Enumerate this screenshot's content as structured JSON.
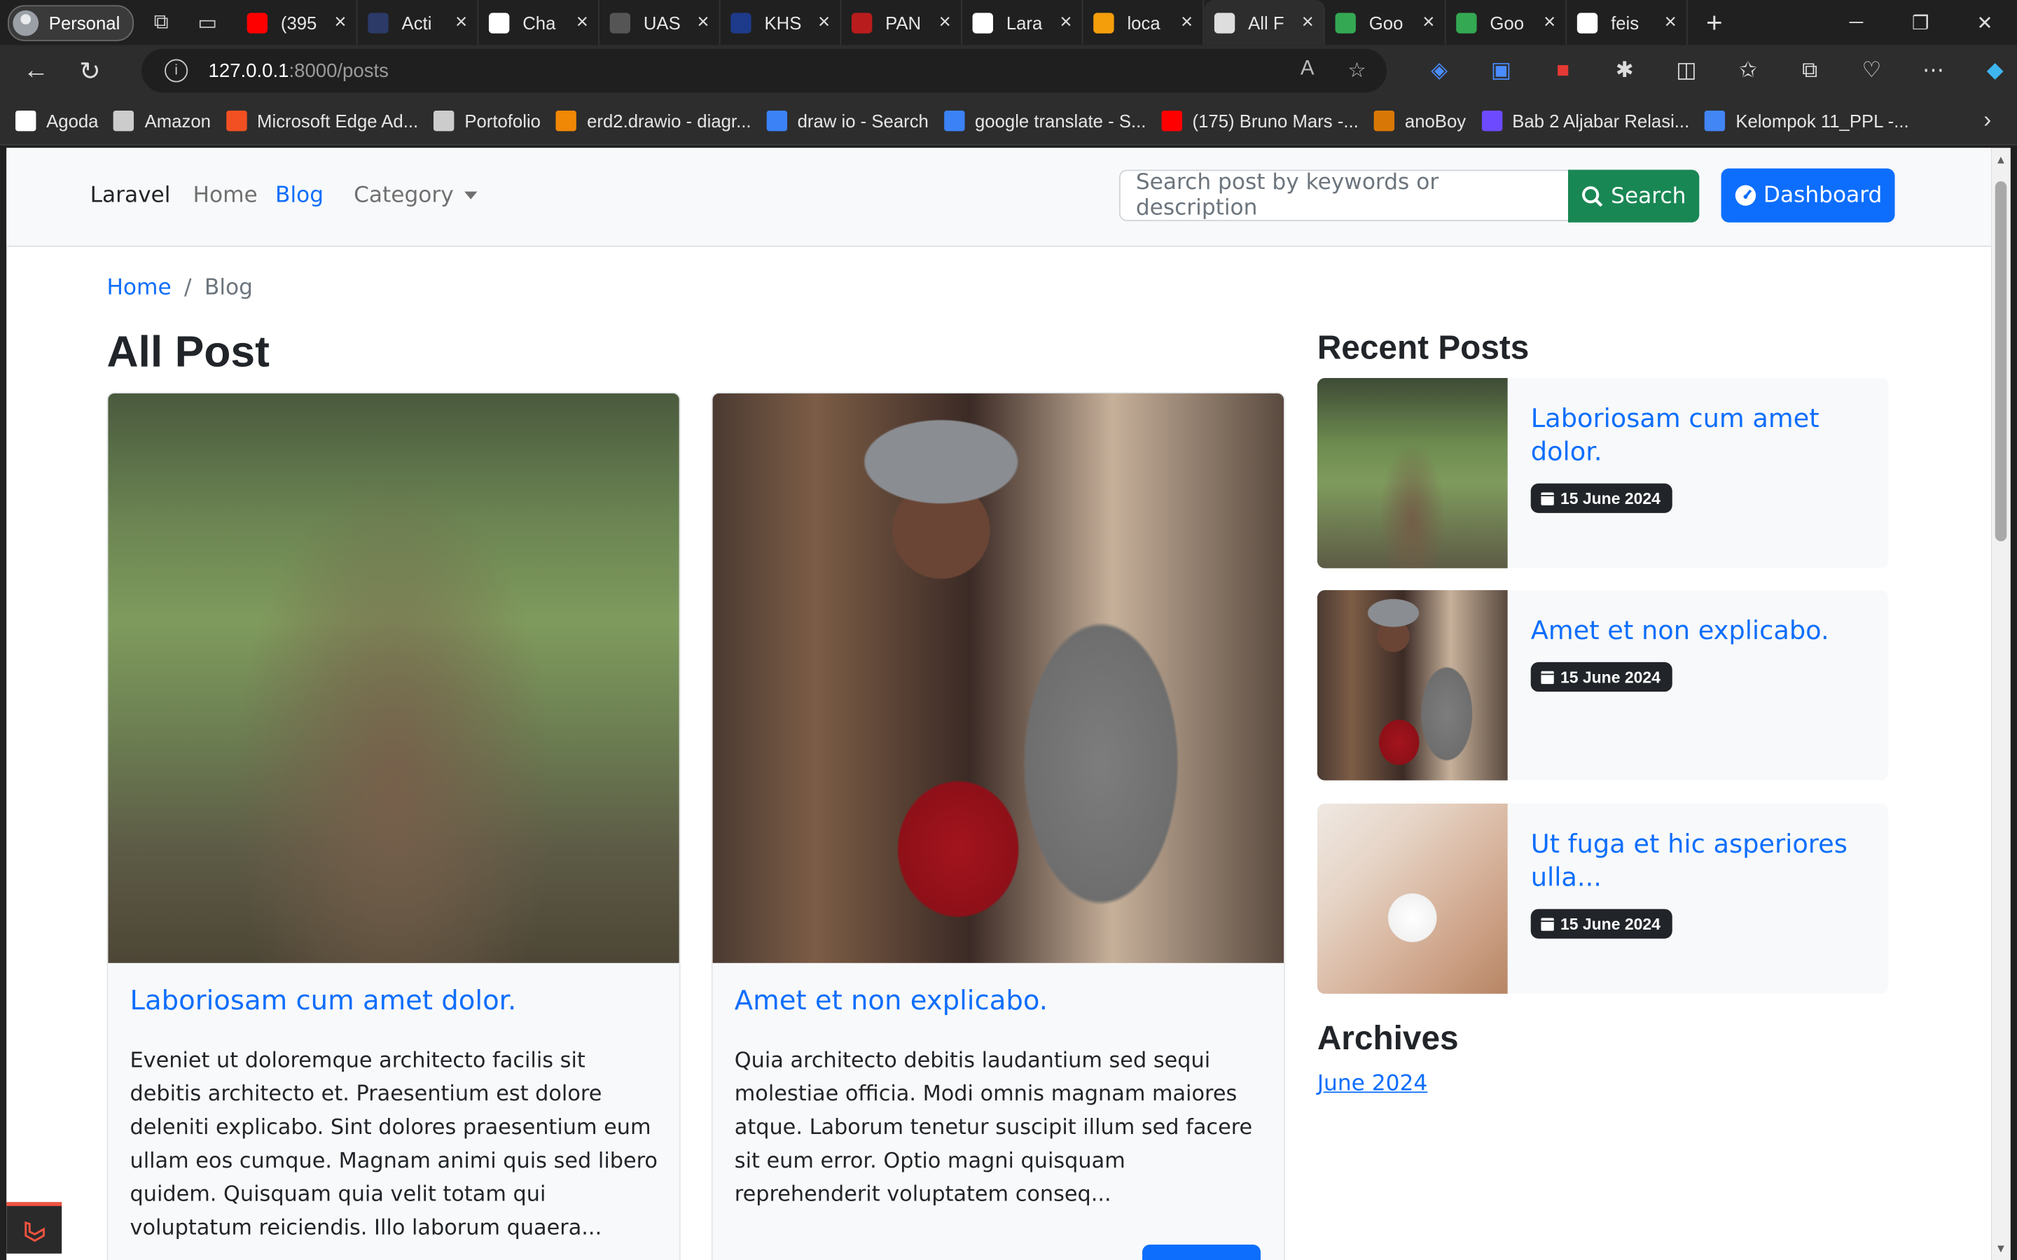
{
  "browser": {
    "profile": "Personal",
    "tabs": [
      {
        "title": "(395",
        "color": "#ff0000"
      },
      {
        "title": "Acti",
        "color": "#2b3a67"
      },
      {
        "title": "Cha",
        "color": "#ffffff"
      },
      {
        "title": "UAS",
        "color": "#555555"
      },
      {
        "title": "KHS",
        "color": "#1e3a8a"
      },
      {
        "title": "PAN",
        "color": "#b91c1c"
      },
      {
        "title": "Lara",
        "color": "#ffffff"
      },
      {
        "title": "loca",
        "color": "#f59e0b"
      },
      {
        "title": "All F",
        "color": "#dddddd",
        "active": true
      },
      {
        "title": "Goo",
        "color": "#34a853"
      },
      {
        "title": "Goo",
        "color": "#34a853"
      },
      {
        "title": "feis",
        "color": "#ffffff"
      }
    ],
    "url_host": "127.0.0.1",
    "url_path": ":8000/posts",
    "bookmarks": [
      {
        "label": "Agoda",
        "color": "#ffffff"
      },
      {
        "label": "Amazon",
        "color": "#cccccc"
      },
      {
        "label": "Microsoft Edge Ad...",
        "color": "#f25022"
      },
      {
        "label": "Portofolio",
        "color": "#cccccc"
      },
      {
        "label": "erd2.drawio - diagr...",
        "color": "#f08705"
      },
      {
        "label": "draw io - Search",
        "color": "#3b82f6"
      },
      {
        "label": "google translate - S...",
        "color": "#3b82f6"
      },
      {
        "label": "(175) Bruno Mars -...",
        "color": "#ff0000"
      },
      {
        "label": "anoBoy",
        "color": "#d97706"
      },
      {
        "label": "Bab 2 Aljabar Relasi...",
        "color": "#6d4aff"
      },
      {
        "label": "Kelompok 11_PPL -...",
        "color": "#4285f4"
      }
    ]
  },
  "site": {
    "brand": "Laravel",
    "nav": {
      "home": "Home",
      "blog": "Blog",
      "category": "Category"
    },
    "search": {
      "placeholder": "Search post by keywords or description",
      "button": "Search"
    },
    "dashboard": "Dashboard"
  },
  "breadcrumb": {
    "home": "Home",
    "current": "Blog"
  },
  "main": {
    "heading": "All Post",
    "posts": [
      {
        "title": "Laboriosam cum amet dolor.",
        "excerpt": "Eveniet ut doloremque architecto facilis sit debitis architecto et. Praesentium est dolore deleniti explicabo. Sint dolores praesentium eum ullam eos cumque. Magnam animi quis sed libero quidem. Quisquam quia velit totam qui voluptatum reiciendis. Illo laborum quaera..."
      },
      {
        "title": "Amet et non explicabo.",
        "excerpt": "Quia architecto debitis laudantium sed sequi molestiae officia. Modi omnis magnam maiores atque. Laborum tenetur suscipit illum sed facere sit eum error. Optio magni quisquam reprehenderit voluptatem conseq..."
      }
    ]
  },
  "sidebar": {
    "recent_heading": "Recent Posts",
    "recent": [
      {
        "title": "Laboriosam cum amet dolor.",
        "date": "15 June 2024"
      },
      {
        "title": "Amet et non explicabo.",
        "date": "15 June 2024"
      },
      {
        "title": "Ut fuga et hic asperiores ulla...",
        "date": "15 June 2024"
      }
    ],
    "archives_heading": "Archives",
    "archives": [
      "June 2024"
    ]
  },
  "colors": {
    "primary": "#0d6efd",
    "success": "#198754",
    "dark": "#212529"
  }
}
